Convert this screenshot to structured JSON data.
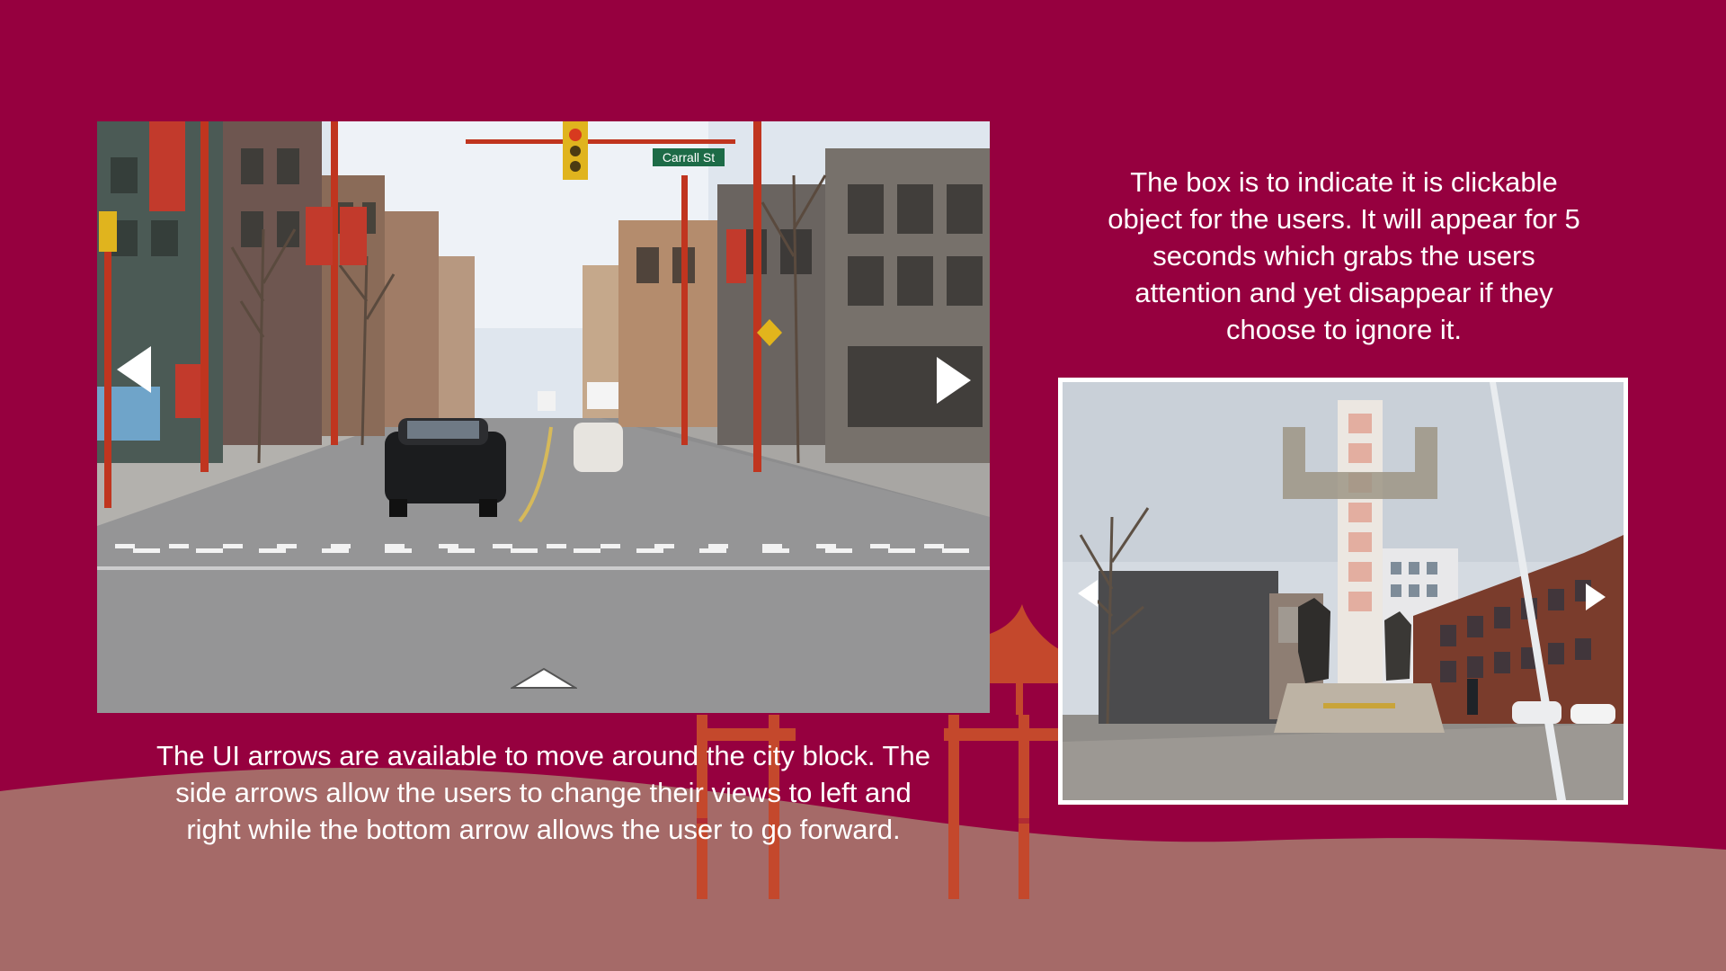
{
  "slide": {
    "background_color": "#96003f",
    "wave_color": "#a56a68",
    "gate_color": "#c4482c"
  },
  "street_view": {
    "street_sign": "Carrall St",
    "arrows": {
      "left_icon": "chevron-left-icon",
      "right_icon": "chevron-right-icon",
      "forward_icon": "chevron-up-icon"
    }
  },
  "monument_view": {
    "arrows": {
      "left_icon": "chevron-left-icon",
      "right_icon": "chevron-right-icon"
    }
  },
  "caption_left": {
    "lines": [
      "The UI arrows are available to move around the city block. The",
      "side arrows allow the users to change their views to left and",
      "right while the bottom arrow allows the user to go forward."
    ]
  },
  "caption_right": {
    "lines": [
      "The box is to indicate it is clickable",
      "object for the users. It will appear for 5",
      "seconds which grabs the users",
      "attention and yet disappear if they",
      "choose to ignore it."
    ]
  }
}
